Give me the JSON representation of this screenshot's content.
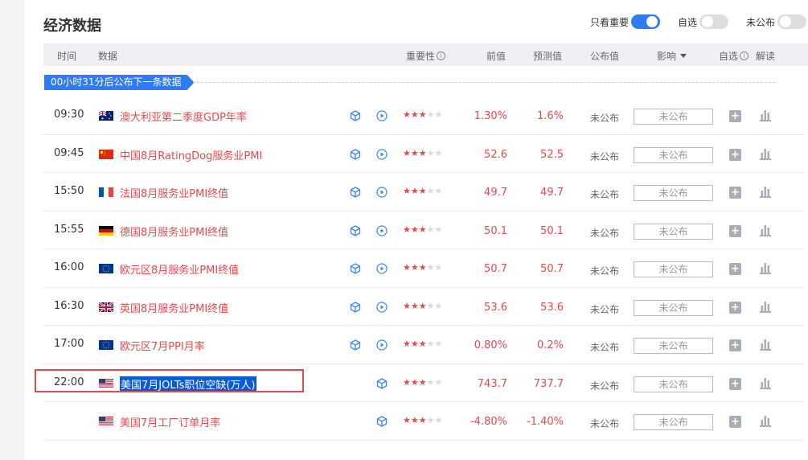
{
  "title": "经济数据",
  "toggles": [
    {
      "label": "只看重要",
      "on": true
    },
    {
      "label": "自选",
      "on": false
    },
    {
      "label": "未公布",
      "on": false
    }
  ],
  "columns": {
    "time": "时间",
    "data": "数据",
    "importance": "重要性",
    "previous": "前值",
    "forecast": "预测值",
    "actual": "公布值",
    "impact": "影响",
    "watchlist": "自选",
    "interpret": "解读"
  },
  "banner": "00小时31分后公布下一条数据",
  "rows": [
    {
      "time": "09:30",
      "flag": "AU",
      "name": "澳大利亚第二季度GDP年率",
      "stars": 3,
      "previous": "1.30%",
      "forecast": "1.6%",
      "status": "未公布",
      "actual_placeholder": "未公布",
      "has_play": true
    },
    {
      "time": "09:45",
      "flag": "CN",
      "name": "中国8月RatingDog服务业PMI",
      "stars": 3,
      "previous": "52.6",
      "forecast": "52.5",
      "status": "未公布",
      "actual_placeholder": "未公布",
      "has_play": true
    },
    {
      "time": "15:50",
      "flag": "FR",
      "name": "法国8月服务业PMI终值",
      "stars": 3,
      "previous": "49.7",
      "forecast": "49.7",
      "status": "未公布",
      "actual_placeholder": "未公布",
      "has_play": true
    },
    {
      "time": "15:55",
      "flag": "DE",
      "name": "德国8月服务业PMI终值",
      "stars": 3,
      "previous": "50.1",
      "forecast": "50.1",
      "status": "未公布",
      "actual_placeholder": "未公布",
      "has_play": true
    },
    {
      "time": "16:00",
      "flag": "EU",
      "name": "欧元区8月服务业PMI终值",
      "stars": 3,
      "previous": "50.7",
      "forecast": "50.7",
      "status": "未公布",
      "actual_placeholder": "未公布",
      "has_play": true
    },
    {
      "time": "16:30",
      "flag": "GB",
      "name": "英国8月服务业PMI终值",
      "stars": 3,
      "previous": "53.6",
      "forecast": "53.6",
      "status": "未公布",
      "actual_placeholder": "未公布",
      "has_play": true
    },
    {
      "time": "17:00",
      "flag": "EU",
      "name": "欧元区7月PPI月率",
      "stars": 3,
      "previous": "0.80%",
      "forecast": "0.2%",
      "status": "未公布",
      "actual_placeholder": "未公布",
      "has_play": true
    },
    {
      "time": "22:00",
      "flag": "US",
      "name": "美国7月JOLTs职位空缺(万人)",
      "stars": 3,
      "previous": "743.7",
      "forecast": "737.7",
      "status": "未公布",
      "actual_placeholder": "未公布",
      "has_play": false,
      "highlighted": true
    },
    {
      "time": "",
      "flag": "US",
      "name": "美国7月工厂订单月率",
      "stars": 3,
      "previous": "-4.80%",
      "forecast": "-1.40%",
      "status": "未公布",
      "actual_placeholder": "未公布",
      "has_play": false
    }
  ],
  "colors": {
    "accent": "#2e7bf6",
    "red": "#e8474c"
  }
}
